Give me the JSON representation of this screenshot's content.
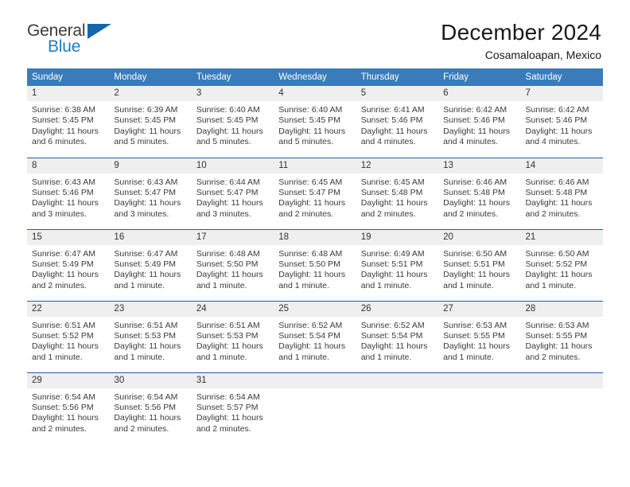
{
  "brand": {
    "name_top": "General",
    "name_bottom": "Blue",
    "color_blue": "#1f7ec4",
    "color_triangle": "#1467ab"
  },
  "header": {
    "title": "December 2024",
    "subtitle": "Cosamaloapan, Mexico"
  },
  "theme": {
    "header_bg": "#3a7cba",
    "row_divider": "#1f5fa0",
    "daynum_bg": "#efefef"
  },
  "columns": [
    "Sunday",
    "Monday",
    "Tuesday",
    "Wednesday",
    "Thursday",
    "Friday",
    "Saturday"
  ],
  "labels": {
    "sunrise_prefix": "Sunrise:",
    "sunset_prefix": "Sunset:",
    "daylight_prefix": "Daylight:"
  },
  "weeks": [
    [
      {
        "day": "1",
        "sunrise": "Sunrise: 6:38 AM",
        "sunset": "Sunset: 5:45 PM",
        "daylight": "Daylight: 11 hours and 6 minutes."
      },
      {
        "day": "2",
        "sunrise": "Sunrise: 6:39 AM",
        "sunset": "Sunset: 5:45 PM",
        "daylight": "Daylight: 11 hours and 5 minutes."
      },
      {
        "day": "3",
        "sunrise": "Sunrise: 6:40 AM",
        "sunset": "Sunset: 5:45 PM",
        "daylight": "Daylight: 11 hours and 5 minutes."
      },
      {
        "day": "4",
        "sunrise": "Sunrise: 6:40 AM",
        "sunset": "Sunset: 5:45 PM",
        "daylight": "Daylight: 11 hours and 5 minutes."
      },
      {
        "day": "5",
        "sunrise": "Sunrise: 6:41 AM",
        "sunset": "Sunset: 5:46 PM",
        "daylight": "Daylight: 11 hours and 4 minutes."
      },
      {
        "day": "6",
        "sunrise": "Sunrise: 6:42 AM",
        "sunset": "Sunset: 5:46 PM",
        "daylight": "Daylight: 11 hours and 4 minutes."
      },
      {
        "day": "7",
        "sunrise": "Sunrise: 6:42 AM",
        "sunset": "Sunset: 5:46 PM",
        "daylight": "Daylight: 11 hours and 4 minutes."
      }
    ],
    [
      {
        "day": "8",
        "sunrise": "Sunrise: 6:43 AM",
        "sunset": "Sunset: 5:46 PM",
        "daylight": "Daylight: 11 hours and 3 minutes."
      },
      {
        "day": "9",
        "sunrise": "Sunrise: 6:43 AM",
        "sunset": "Sunset: 5:47 PM",
        "daylight": "Daylight: 11 hours and 3 minutes."
      },
      {
        "day": "10",
        "sunrise": "Sunrise: 6:44 AM",
        "sunset": "Sunset: 5:47 PM",
        "daylight": "Daylight: 11 hours and 3 minutes."
      },
      {
        "day": "11",
        "sunrise": "Sunrise: 6:45 AM",
        "sunset": "Sunset: 5:47 PM",
        "daylight": "Daylight: 11 hours and 2 minutes."
      },
      {
        "day": "12",
        "sunrise": "Sunrise: 6:45 AM",
        "sunset": "Sunset: 5:48 PM",
        "daylight": "Daylight: 11 hours and 2 minutes."
      },
      {
        "day": "13",
        "sunrise": "Sunrise: 6:46 AM",
        "sunset": "Sunset: 5:48 PM",
        "daylight": "Daylight: 11 hours and 2 minutes."
      },
      {
        "day": "14",
        "sunrise": "Sunrise: 6:46 AM",
        "sunset": "Sunset: 5:48 PM",
        "daylight": "Daylight: 11 hours and 2 minutes."
      }
    ],
    [
      {
        "day": "15",
        "sunrise": "Sunrise: 6:47 AM",
        "sunset": "Sunset: 5:49 PM",
        "daylight": "Daylight: 11 hours and 2 minutes."
      },
      {
        "day": "16",
        "sunrise": "Sunrise: 6:47 AM",
        "sunset": "Sunset: 5:49 PM",
        "daylight": "Daylight: 11 hours and 1 minute."
      },
      {
        "day": "17",
        "sunrise": "Sunrise: 6:48 AM",
        "sunset": "Sunset: 5:50 PM",
        "daylight": "Daylight: 11 hours and 1 minute."
      },
      {
        "day": "18",
        "sunrise": "Sunrise: 6:48 AM",
        "sunset": "Sunset: 5:50 PM",
        "daylight": "Daylight: 11 hours and 1 minute."
      },
      {
        "day": "19",
        "sunrise": "Sunrise: 6:49 AM",
        "sunset": "Sunset: 5:51 PM",
        "daylight": "Daylight: 11 hours and 1 minute."
      },
      {
        "day": "20",
        "sunrise": "Sunrise: 6:50 AM",
        "sunset": "Sunset: 5:51 PM",
        "daylight": "Daylight: 11 hours and 1 minute."
      },
      {
        "day": "21",
        "sunrise": "Sunrise: 6:50 AM",
        "sunset": "Sunset: 5:52 PM",
        "daylight": "Daylight: 11 hours and 1 minute."
      }
    ],
    [
      {
        "day": "22",
        "sunrise": "Sunrise: 6:51 AM",
        "sunset": "Sunset: 5:52 PM",
        "daylight": "Daylight: 11 hours and 1 minute."
      },
      {
        "day": "23",
        "sunrise": "Sunrise: 6:51 AM",
        "sunset": "Sunset: 5:53 PM",
        "daylight": "Daylight: 11 hours and 1 minute."
      },
      {
        "day": "24",
        "sunrise": "Sunrise: 6:51 AM",
        "sunset": "Sunset: 5:53 PM",
        "daylight": "Daylight: 11 hours and 1 minute."
      },
      {
        "day": "25",
        "sunrise": "Sunrise: 6:52 AM",
        "sunset": "Sunset: 5:54 PM",
        "daylight": "Daylight: 11 hours and 1 minute."
      },
      {
        "day": "26",
        "sunrise": "Sunrise: 6:52 AM",
        "sunset": "Sunset: 5:54 PM",
        "daylight": "Daylight: 11 hours and 1 minute."
      },
      {
        "day": "27",
        "sunrise": "Sunrise: 6:53 AM",
        "sunset": "Sunset: 5:55 PM",
        "daylight": "Daylight: 11 hours and 1 minute."
      },
      {
        "day": "28",
        "sunrise": "Sunrise: 6:53 AM",
        "sunset": "Sunset: 5:55 PM",
        "daylight": "Daylight: 11 hours and 2 minutes."
      }
    ],
    [
      {
        "day": "29",
        "sunrise": "Sunrise: 6:54 AM",
        "sunset": "Sunset: 5:56 PM",
        "daylight": "Daylight: 11 hours and 2 minutes."
      },
      {
        "day": "30",
        "sunrise": "Sunrise: 6:54 AM",
        "sunset": "Sunset: 5:56 PM",
        "daylight": "Daylight: 11 hours and 2 minutes."
      },
      {
        "day": "31",
        "sunrise": "Sunrise: 6:54 AM",
        "sunset": "Sunset: 5:57 PM",
        "daylight": "Daylight: 11 hours and 2 minutes."
      },
      {
        "day": "",
        "sunrise": "",
        "sunset": "",
        "daylight": ""
      },
      {
        "day": "",
        "sunrise": "",
        "sunset": "",
        "daylight": ""
      },
      {
        "day": "",
        "sunrise": "",
        "sunset": "",
        "daylight": ""
      },
      {
        "day": "",
        "sunrise": "",
        "sunset": "",
        "daylight": ""
      }
    ]
  ]
}
